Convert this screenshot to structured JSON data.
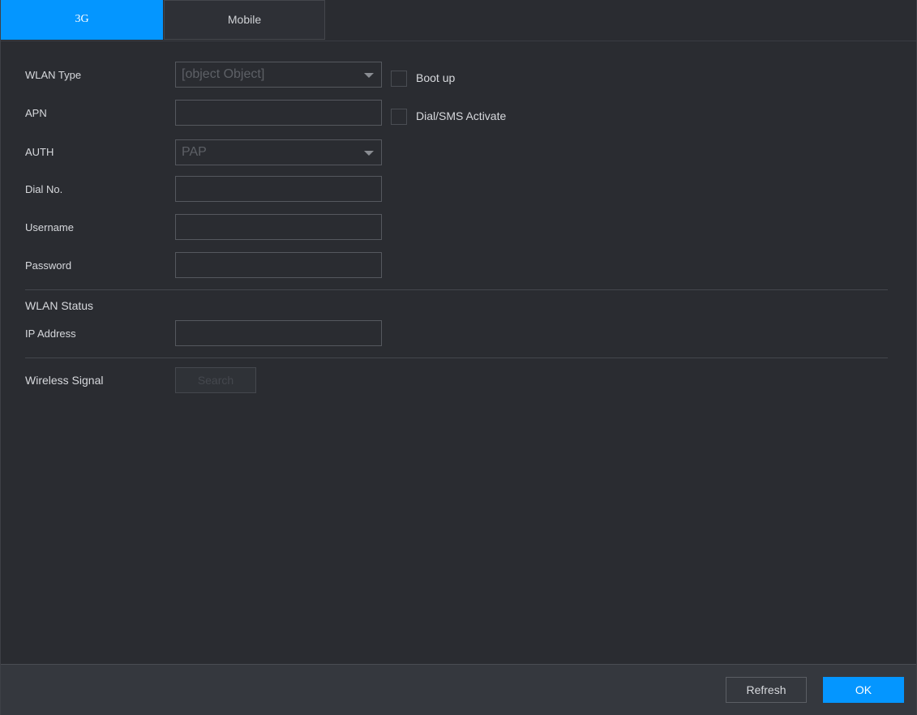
{
  "tabs": [
    {
      "label": "3G",
      "active": true
    },
    {
      "label": "Mobile",
      "active": false
    }
  ],
  "form": {
    "wlan_type": {
      "label": "WLAN Type",
      "value": "[object Object]"
    },
    "apn": {
      "label": "APN",
      "value": ""
    },
    "auth": {
      "label": "AUTH",
      "value": "PAP"
    },
    "dial_no": {
      "label": "Dial No.",
      "value": ""
    },
    "username": {
      "label": "Username",
      "value": ""
    },
    "password": {
      "label": "Password",
      "value": ""
    },
    "boot_up": {
      "label": "Boot up",
      "checked": false
    },
    "dial_sms": {
      "label": "Dial/SMS Activate",
      "checked": false
    }
  },
  "status": {
    "title": "WLAN Status",
    "ip_address": {
      "label": "IP Address",
      "value": ""
    }
  },
  "wireless": {
    "label": "Wireless Signal",
    "search_label": "Search"
  },
  "footer": {
    "refresh_label": "Refresh",
    "ok_label": "OK"
  },
  "colors": {
    "accent": "#0496ff",
    "background": "#2a2c31",
    "footer": "#35383e"
  }
}
